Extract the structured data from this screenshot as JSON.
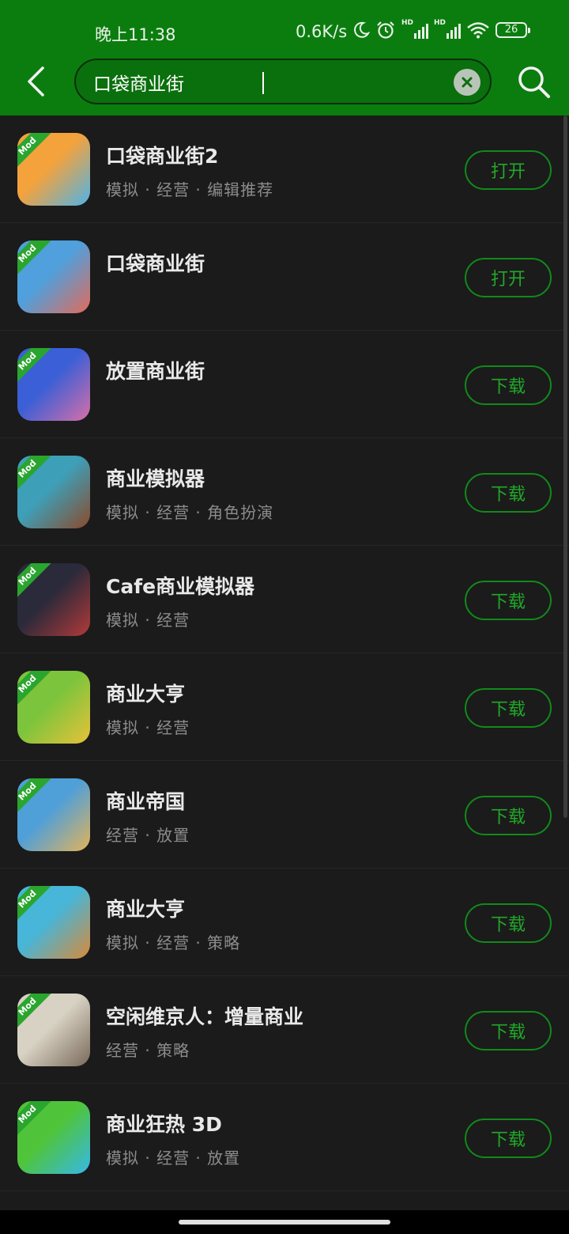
{
  "status_bar": {
    "time": "晚上11:38",
    "net_speed": "0.6K/s",
    "signal_label": "HD",
    "battery": "26"
  },
  "search": {
    "query": "口袋商业街"
  },
  "colors": {
    "header_bg": "#0b7d0f",
    "accent": "#21a828",
    "list_bg": "#1b1b1b"
  },
  "results": [
    {
      "name": "口袋商业街2",
      "tags": "模拟 · 经营 · 编辑推荐",
      "action": "打开",
      "icon_colors": [
        "#f4a23c",
        "#4fb3e8"
      ]
    },
    {
      "name": "口袋商业街",
      "tags": "",
      "action": "打开",
      "icon_colors": [
        "#4fa0dc",
        "#e26b5a"
      ]
    },
    {
      "name": "放置商业街",
      "tags": "",
      "action": "下载",
      "icon_colors": [
        "#3a5fd6",
        "#d86fa8"
      ]
    },
    {
      "name": "商业模拟器",
      "tags": "模拟 · 经营 · 角色扮演",
      "action": "下载",
      "icon_colors": [
        "#3e9fb8",
        "#8a4a2a"
      ]
    },
    {
      "name": "Cafe商业模拟器",
      "tags": "模拟 · 经营",
      "action": "下载",
      "icon_colors": [
        "#2a2a3a",
        "#b23a3a"
      ]
    },
    {
      "name": "商业大亨",
      "tags": "模拟 · 经营",
      "action": "下载",
      "icon_colors": [
        "#7cc43c",
        "#e8c23a"
      ]
    },
    {
      "name": "商业帝国",
      "tags": "经营 · 放置",
      "action": "下载",
      "icon_colors": [
        "#4f9fd8",
        "#e2b45a"
      ]
    },
    {
      "name": "商业大亨",
      "tags": "模拟 · 经营 · 策略",
      "action": "下载",
      "icon_colors": [
        "#47b6d8",
        "#d88a3a"
      ]
    },
    {
      "name": "空闲维京人：增量商业",
      "tags": "经营 · 策略",
      "action": "下载",
      "icon_colors": [
        "#d8d2c4",
        "#7a6a5a"
      ]
    },
    {
      "name": "商业狂热 3D",
      "tags": "模拟 · 经营 · 放置",
      "action": "下载",
      "icon_colors": [
        "#4fc43a",
        "#38b8e8"
      ]
    }
  ],
  "mod_badge": "Mod"
}
